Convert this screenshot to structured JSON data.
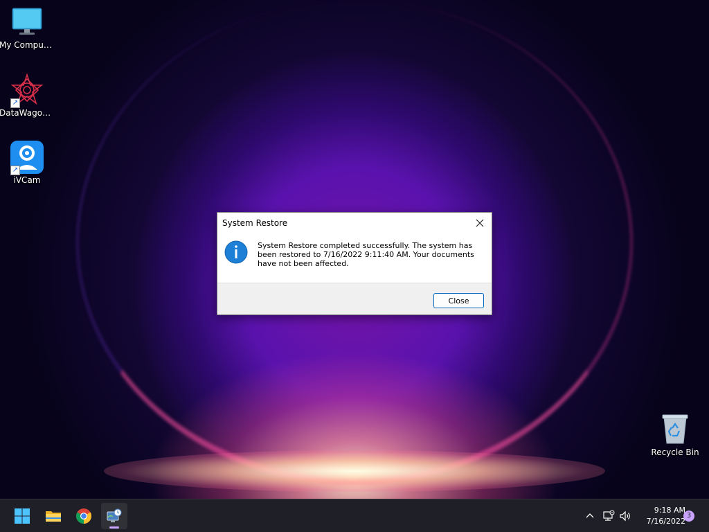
{
  "desktop": {
    "icons": [
      {
        "label": "My Computer",
        "icon": "monitor-icon"
      },
      {
        "label": "DataWagon...",
        "icon": "datawagon-logo-icon",
        "shortcut": true
      },
      {
        "label": "iVCam",
        "icon": "ivcam-icon",
        "shortcut": true
      },
      {
        "label": "Recycle Bin",
        "icon": "recycle-bin-icon"
      }
    ]
  },
  "dialog": {
    "title": "System Restore",
    "message": "System Restore completed successfully. The system has been restored to 7/16/2022 9:11:40 AM. Your documents have not been affected.",
    "close_label": "Close",
    "icon": "info-icon"
  },
  "taskbar": {
    "buttons": [
      {
        "name": "start",
        "icon": "windows-start-icon"
      },
      {
        "name": "file-explorer",
        "icon": "folder-icon"
      },
      {
        "name": "chrome",
        "icon": "chrome-icon"
      },
      {
        "name": "system-restore",
        "icon": "system-restore-icon",
        "active": true
      }
    ],
    "tray": {
      "overflow_icon": "chevron-up-icon",
      "network_icon": "network-icon",
      "volume_icon": "volume-icon"
    },
    "time": "9:18 AM",
    "date": "7/16/2022",
    "notification_count": "3"
  },
  "colors": {
    "accent": "#0067c0",
    "info_blue": "#1e7fd6",
    "taskbar_bg": "#1f1f27",
    "badge": "#c9a3ff"
  }
}
